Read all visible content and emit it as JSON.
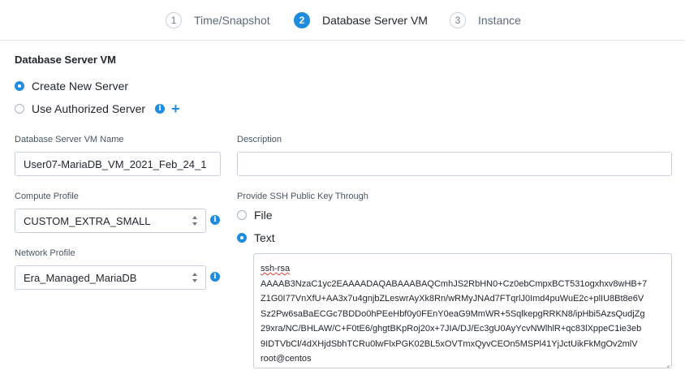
{
  "wizard": {
    "steps": [
      {
        "number": "1",
        "label": "Time/Snapshot"
      },
      {
        "number": "2",
        "label": "Database Server VM"
      },
      {
        "number": "3",
        "label": "Instance"
      }
    ],
    "active_step": "2"
  },
  "section": {
    "title": "Database Server VM",
    "options": [
      {
        "label": "Create New Server",
        "selected": true
      },
      {
        "label": "Use Authorized Server",
        "selected": false
      }
    ]
  },
  "form": {
    "vm_name": {
      "label": "Database Server VM Name",
      "value": "User07-MariaDB_VM_2021_Feb_24_1"
    },
    "description": {
      "label": "Description",
      "value": ""
    },
    "compute_profile": {
      "label": "Compute Profile",
      "value": "CUSTOM_EXTRA_SMALL"
    },
    "network_profile": {
      "label": "Network Profile",
      "value": "Era_Managed_MariaDB"
    },
    "ssh": {
      "label": "Provide SSH Public Key Through",
      "options": [
        {
          "label": "File",
          "selected": false
        },
        {
          "label": "Text",
          "selected": true
        }
      ],
      "key_lines": [
        "ssh-rsa",
        "AAAAB3NzaC1yc2EAAAADAQABAAABAQCmhJS2RbHN0+Cz0ebCmpxBCT531ogxhxv8wHB+7",
        "Z1G0I77VnXfU+AA3x7u4gnjbZLeswrAyXk8Rn/wRMyJNAd7FTqrlJ0Imd4puWuE2c+plIU8Bt8e6V",
        "Sz2Pw6saBaECGc7BDDo0hPEeHbf0y0FEnY0eaG9MmWR+5SqlkepgRRKN8/ipHbi5AzsQudjZg",
        "29xra/NC/BHLAW/C+F0tE6/ghgtBKpRoj20x+7JIA/DJ/Ec3gU0AyYcvNWlhlR+qc83lXppeC1ie3eb",
        "9IDTVbCl/4dXHjdSbhTCRu0lwFlxPGK02BL5xOVTmxQyvCEOn5MSPl41YjJctUikFkMgOv2mlV",
        "root@centos"
      ]
    }
  },
  "colors": {
    "accent": "#1f8ce0",
    "border": "#c9d2dc",
    "text": "#22272e"
  },
  "icons": [
    "info-icon",
    "plus-icon",
    "chevron-updown-icon",
    "resize-handle-icon"
  ]
}
